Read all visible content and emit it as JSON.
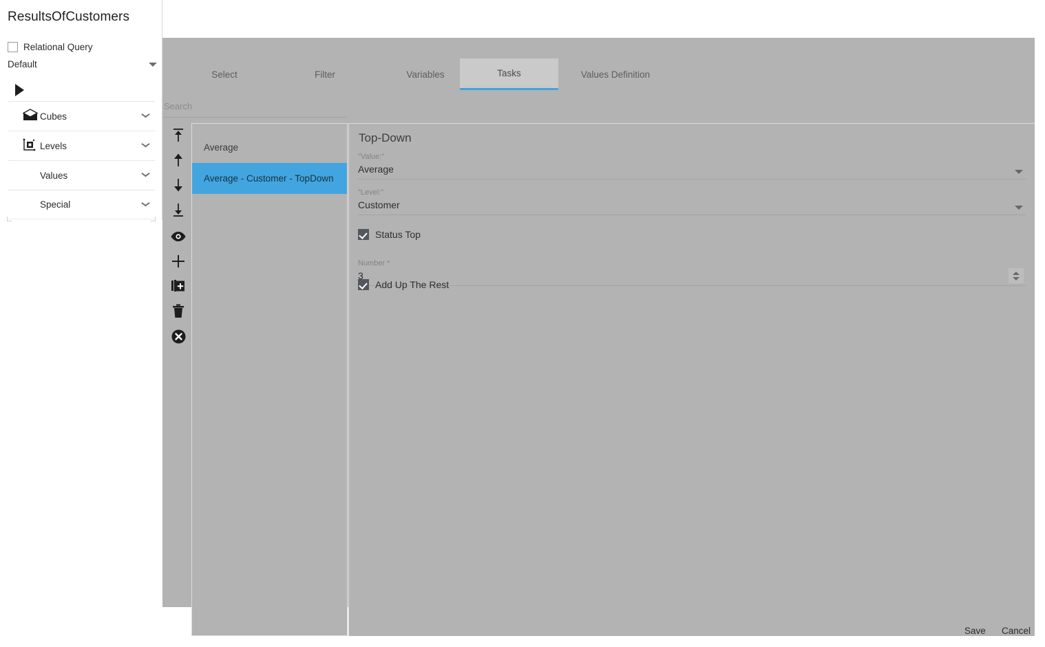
{
  "page": {
    "title": "ResultsOfCustomers"
  },
  "sidebar": {
    "relational_query": {
      "label": "Relational Query",
      "checked": false
    },
    "default_select": {
      "value": "Default",
      "caret_icon": "caret-down-icon"
    },
    "run_button": {
      "icon": "play-triangle-icon"
    },
    "items": [
      {
        "label": "Cubes",
        "icon": "cube-envelope-icon",
        "chevron": "chevron-down-icon"
      },
      {
        "label": "Levels",
        "icon": "levels-axis-icon",
        "chevron": "chevron-down-icon"
      },
      {
        "label": "Values",
        "icon": "",
        "chevron": "chevron-down-icon"
      },
      {
        "label": "Special",
        "icon": "",
        "chevron": "chevron-down-icon"
      }
    ]
  },
  "tabs": [
    {
      "label": "Select",
      "active": false
    },
    {
      "label": "Filter",
      "active": false
    },
    {
      "label": "Variables",
      "active": false
    },
    {
      "label": "Tasks",
      "active": true
    },
    {
      "label": "Values Definition",
      "active": false
    }
  ],
  "search": {
    "placeholder": "Search",
    "value": ""
  },
  "toolbar": {
    "buttons": [
      {
        "name": "move-to-top-icon",
        "title": "Move To Top"
      },
      {
        "name": "move-up-icon",
        "title": "Move Up"
      },
      {
        "name": "move-down-icon",
        "title": "Move Down"
      },
      {
        "name": "move-to-bottom-icon",
        "title": "Move To Bottom"
      },
      {
        "name": "eye-icon",
        "title": "Show"
      },
      {
        "name": "plus-icon",
        "title": "Add"
      },
      {
        "name": "duplicate-icon",
        "title": "Duplicate"
      },
      {
        "name": "trash-icon",
        "title": "Delete"
      },
      {
        "name": "circle-x-icon",
        "title": "Remove All"
      }
    ]
  },
  "task_list": [
    {
      "label": "Average",
      "selected": false
    },
    {
      "label": "Average - Customer - TopDown",
      "selected": true
    }
  ],
  "detail": {
    "title": "Top-Down",
    "value_field": {
      "label": "\"Value:\"",
      "value": "Average",
      "caret_icon": "caret-down-icon"
    },
    "level_field": {
      "label": "\"Level:\"",
      "value": "Customer",
      "caret_icon": "caret-down-icon"
    },
    "status_top": {
      "label": "Status Top",
      "checked": true
    },
    "number_field": {
      "label": "Number *",
      "value": "3",
      "spinner_icon": "spinner-updown-icon"
    },
    "add_up_the_rest": {
      "label": "Add Up The Rest",
      "checked": true
    }
  },
  "footer": {
    "save_label": "Save",
    "cancel_label": "Cancel"
  },
  "colors": {
    "panel_bg": "#b3b3b3",
    "active_tab_bg": "#cacaca",
    "accent_blue": "#3fa3e0",
    "selection_blue": "#42a5e0",
    "checkbox_fill": "#55575f"
  }
}
